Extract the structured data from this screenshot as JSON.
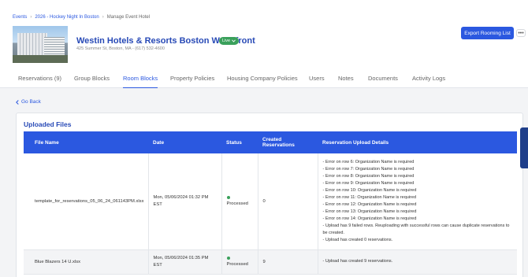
{
  "breadcrumb": {
    "items": [
      {
        "label": "Events",
        "link": true
      },
      {
        "label": "2026 - Hockey Night In Boston",
        "link": true
      },
      {
        "label": "Manage Event Hotel",
        "link": false
      }
    ],
    "separator": "›"
  },
  "hotel": {
    "name": "Westin Hotels & Resorts Boston Waterfront",
    "status": "Live",
    "address": "425 Summer St, Boston, MA - (617) 532-4600"
  },
  "actions": {
    "export_label": "Export Rooming List",
    "more_label": "•••"
  },
  "tabs": [
    {
      "label": "Reservations (9)",
      "active": false
    },
    {
      "label": "Group Blocks",
      "active": false
    },
    {
      "label": "Room Blocks",
      "active": true
    },
    {
      "label": "Property Policies",
      "active": false
    },
    {
      "label": "Housing Company Policies",
      "active": false
    },
    {
      "label": "Users",
      "active": false
    },
    {
      "label": "Notes",
      "active": false
    },
    {
      "label": "Documents",
      "active": false
    },
    {
      "label": "Activity Logs",
      "active": false
    }
  ],
  "back_label": "Go Back",
  "uploads": {
    "title": "Uploaded Files",
    "columns": [
      "File Name",
      "Date",
      "Status",
      "Created Reservations",
      "Reservation Upload Details"
    ],
    "rows": [
      {
        "file_name": "template_for_reservations_05_06_24_061143PM.xlsx",
        "date": "Mon, 05/06/2024 01:32 PM EST",
        "status": "Processed",
        "created": "0",
        "details": [
          "- Error on row 6: Organization Name is required",
          "- Error on row 7: Organization Name is required",
          "- Error on row 8: Organization Name is required",
          "- Error on row 9: Organization Name is required",
          "- Error on row 10: Organization Name is required",
          "- Error on row 11: Organization Name is required",
          "- Error on row 12: Organization Name is required",
          "- Error on row 13: Organization Name is required",
          "- Error on row 14: Organization Name is required",
          "- Upload has 9 failed rows. Reuploading with successful rows can cause duplicate reservations to be created.",
          "- Upload has created 0 reservations."
        ]
      },
      {
        "file_name": "Blue Blazers 14 U.xlsx",
        "date": "Mon, 05/06/2024 01:35 PM EST",
        "status": "Processed",
        "created": "9",
        "details": [
          "- Upload has created 9 reservations."
        ]
      }
    ]
  },
  "colors": {
    "primary": "#2b58e0",
    "title_blue": "#2749b6",
    "live_green": "#3aa05b",
    "side_tab": "#1f3f8a"
  }
}
